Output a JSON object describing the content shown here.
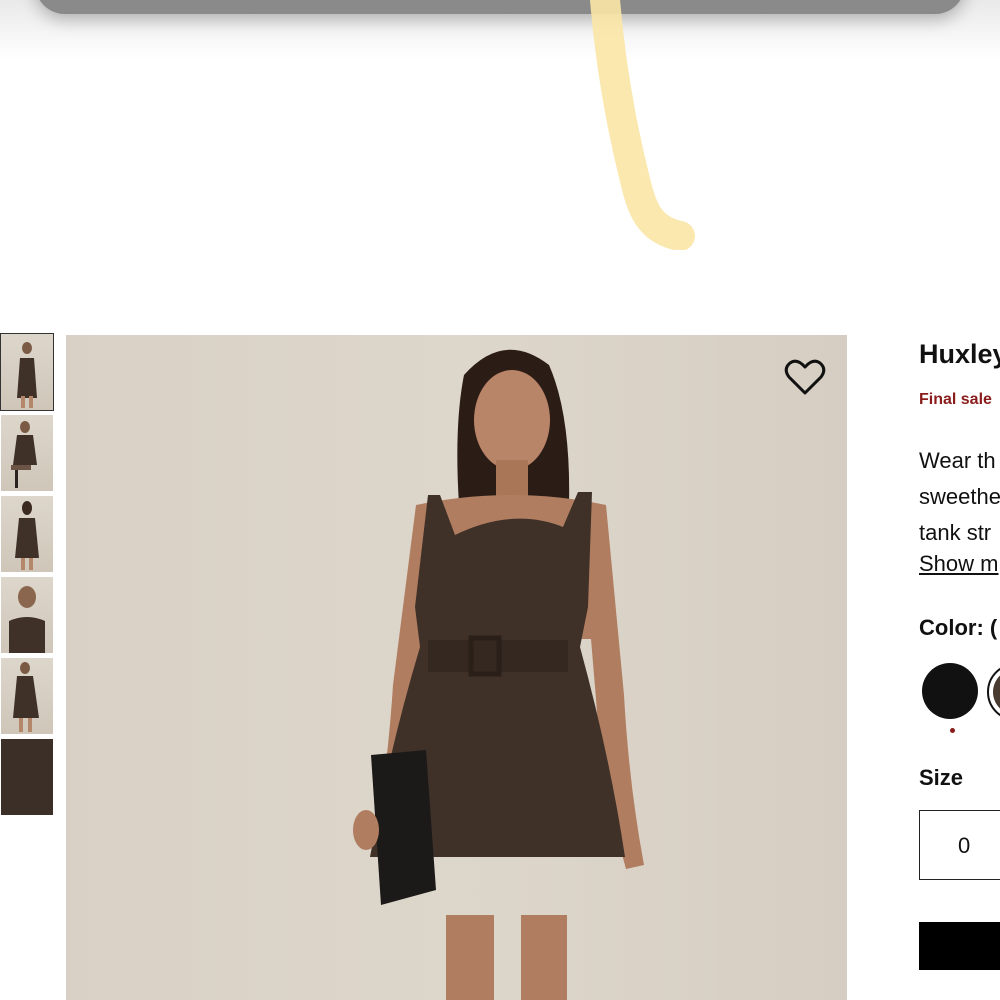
{
  "product": {
    "title": "Huxley",
    "final_sale": "Final sale",
    "description_lines": [
      "Wear th",
      "sweethe",
      "tank str"
    ],
    "show_more": "Show m",
    "color_label": "Color: (",
    "size_label": "Size",
    "size_value": "0"
  },
  "gallery": {
    "thumbnails": [
      "front",
      "seated",
      "back",
      "closeup",
      "angle",
      "fabric-swatch"
    ],
    "active_index": 0
  },
  "colors": {
    "dress": "#3f3128",
    "accent_red": "#8a1c1c",
    "swatch_black": "#111111",
    "swatch_brown": "#4a3b31"
  }
}
